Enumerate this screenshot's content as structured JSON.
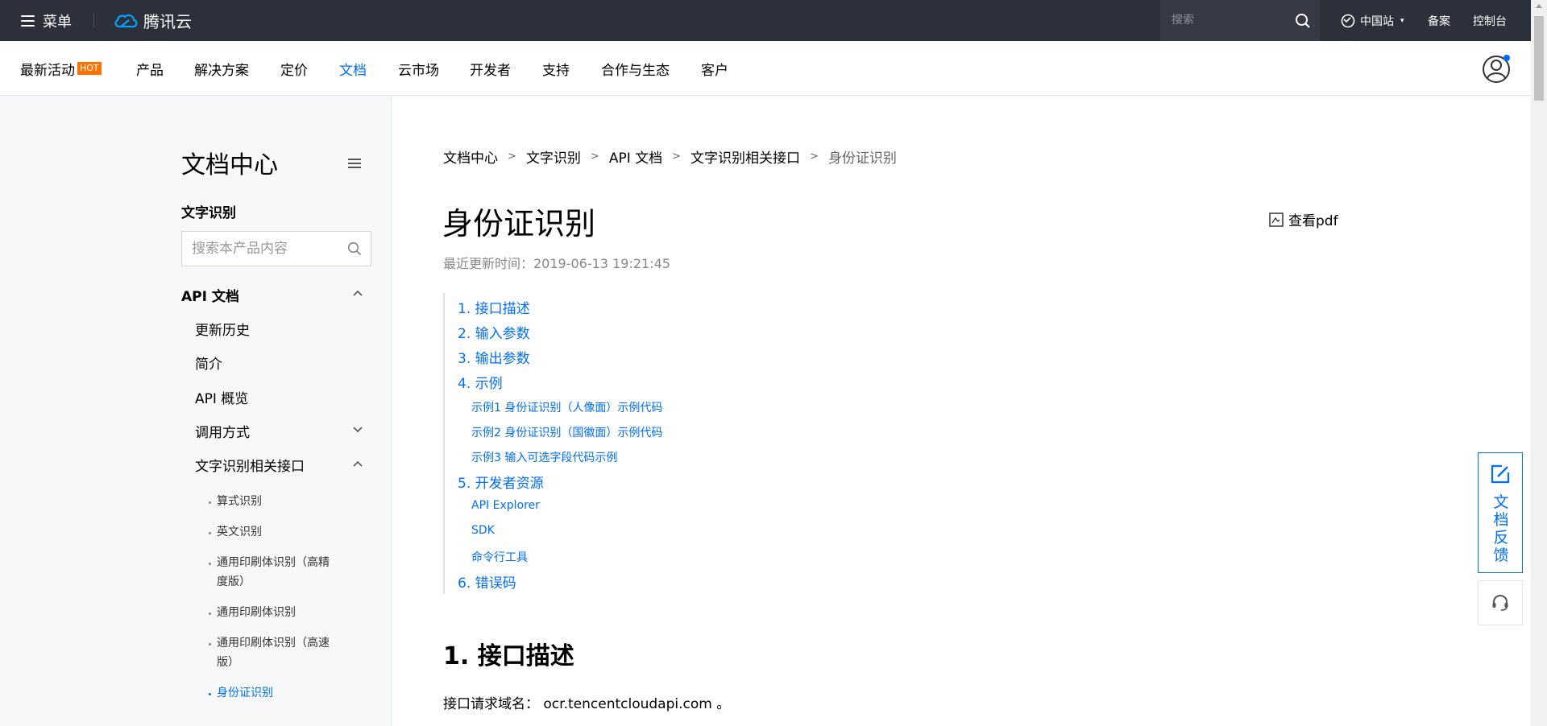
{
  "topbar": {
    "menu_label": "菜单",
    "logo_text": "腾讯云",
    "search_placeholder": "搜索",
    "site_label": "中国站",
    "beian_label": "备案",
    "console_label": "控制台"
  },
  "nav": {
    "items": [
      {
        "label": "最新活动",
        "badge": "HOT"
      },
      {
        "label": "产品"
      },
      {
        "label": "解决方案"
      },
      {
        "label": "定价"
      },
      {
        "label": "文档"
      },
      {
        "label": "云市场"
      },
      {
        "label": "开发者"
      },
      {
        "label": "支持"
      },
      {
        "label": "合作与生态"
      },
      {
        "label": "客户"
      }
    ],
    "active_index": 4
  },
  "sidebar": {
    "title": "文档中心",
    "product": "文字识别",
    "search_placeholder": "搜索本产品内容",
    "section": "API 文档",
    "items": [
      "更新历史",
      "简介",
      "API 概览",
      "调用方式",
      "文字识别相关接口"
    ],
    "sub_items": [
      "算式识别",
      "英文识别",
      "通用印刷体识别（高精度版）",
      "通用印刷体识别",
      "通用印刷体识别（高速版）",
      "身份证识别"
    ]
  },
  "breadcrumb": [
    "文档中心",
    "文字识别",
    "API 文档",
    "文字识别相关接口",
    "身份证识别"
  ],
  "page": {
    "title": "身份证识别",
    "pdf_label": "查看pdf",
    "updated": "最近更新时间：2019-06-13 19:21:45"
  },
  "toc": {
    "i1": "1. 接口描述",
    "i2": "2. 输入参数",
    "i3": "3. 输出参数",
    "i4": "4. 示例",
    "s1": "示例1 身份证识别（人像面）示例代码",
    "s2": "示例2 身份证识别（国徽面）示例代码",
    "s3": "示例3 输入可选字段代码示例",
    "i5": "5. 开发者资源",
    "s4": "API Explorer",
    "s5": "SDK",
    "s6": "命令行工具",
    "i6": "6. 错误码"
  },
  "content": {
    "section_title": "1. 接口描述",
    "paragraph": "接口请求域名： ocr.tencentcloudapi.com 。"
  },
  "float": {
    "feedback": "文档反馈"
  },
  "colors": {
    "accent": "#006eff",
    "topbar": "#2b303b",
    "hot": "#ff7200"
  }
}
